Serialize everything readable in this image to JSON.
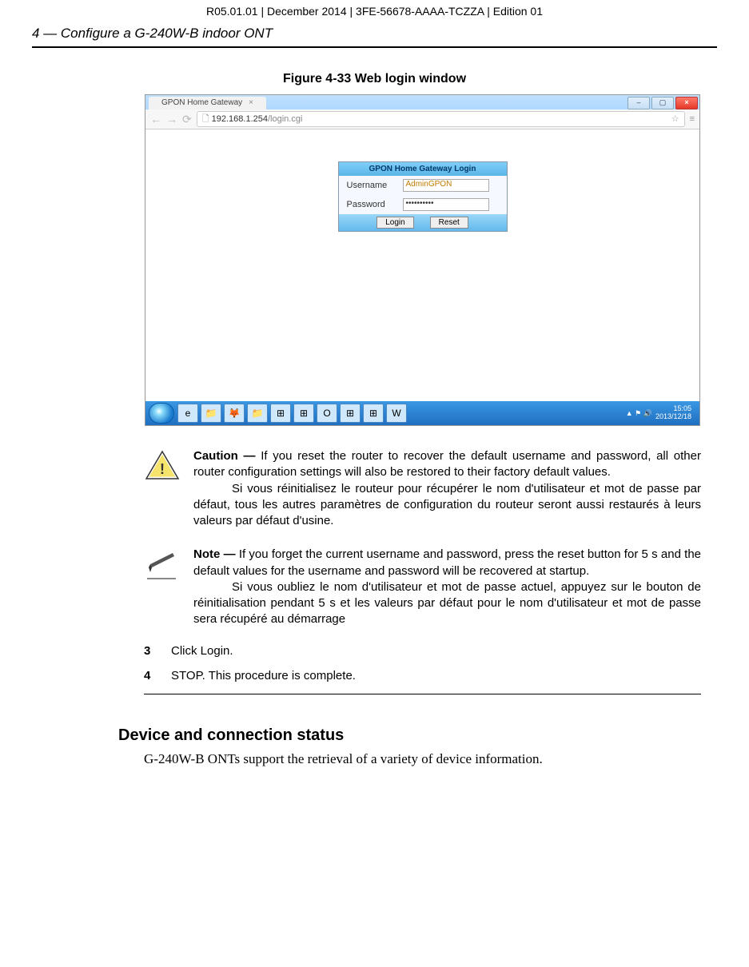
{
  "header": {
    "top_line": "R05.01.01 | December 2014 | 3FE-56678-AAAA-TCZZA | Edition 01",
    "section": "4 —  Configure a G-240W-B indoor ONT"
  },
  "figure": {
    "caption": "Figure 4-33  Web login window"
  },
  "browser": {
    "tab_title": "GPON Home Gateway",
    "url_host": "192.168.1.254",
    "url_path": "/login.cgi",
    "min_label": "–",
    "max_label": "▢",
    "close_label": "×",
    "nav_back": "←",
    "nav_fwd": "→",
    "reload": "⟳",
    "star": "☆",
    "menu": "≡"
  },
  "login": {
    "title": "GPON Home Gateway Login",
    "username_label": "Username",
    "username_value": "AdminGPON",
    "password_label": "Password",
    "password_value": "••••••••••",
    "login_btn": "Login",
    "reset_btn": "Reset"
  },
  "taskbar": {
    "icons": [
      "e",
      "📁",
      "🦊",
      "📁",
      "⊞",
      "⊞",
      "O",
      "⊞",
      "⊞",
      "W"
    ],
    "tray_glyph": "▲ ⚑ 🔊",
    "clock_time": "15:05",
    "clock_date": "2013/12/18"
  },
  "caution": {
    "lead": "Caution —  ",
    "text_en": "If you reset the router to recover the default username and password, all other router configuration settings will also be restored to their factory default values.",
    "text_fr": "Si vous réinitialisez le routeur pour récupérer le nom d'utilisateur et mot de passe par défaut, tous les autres paramètres de configuration du routeur seront aussi restaurés à leurs valeurs par défaut d'usine."
  },
  "note": {
    "lead": "Note —  ",
    "text_en": "If you forget the current username and password, press the reset button for 5 s and the default values for the username and password will be recovered at startup.",
    "text_fr": "Si vous oubliez le nom d'utilisateur et mot de passe actuel, appuyez sur le bouton de réinitialisation pendant 5 s et les valeurs par défaut pour le nom d'utilisateur et mot de passe sera récupéré au démarrage"
  },
  "steps": {
    "s3_num": "3",
    "s3_text": "Click Login.",
    "s4_num": "4",
    "s4_text": "STOP. This procedure is complete."
  },
  "section2": {
    "heading": "Device and connection status",
    "line": "G-240W-B ONTs support the retrieval of a variety of device information."
  }
}
